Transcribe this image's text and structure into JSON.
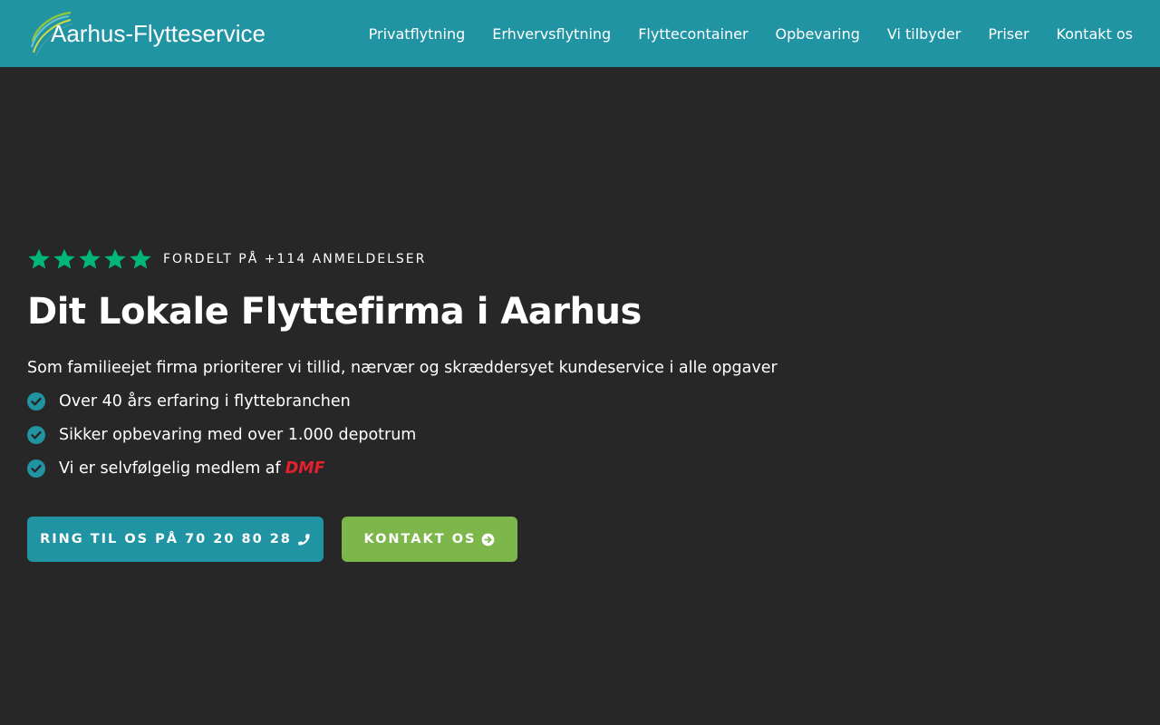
{
  "header": {
    "logo_text": "Aarhus-Flytteservice",
    "nav": [
      {
        "label": "Privatflytning"
      },
      {
        "label": "Erhvervsflytning"
      },
      {
        "label": "Flyttecontainer"
      },
      {
        "label": "Opbevaring"
      },
      {
        "label": "Vi tilbyder"
      },
      {
        "label": "Priser"
      },
      {
        "label": "Kontakt os"
      }
    ]
  },
  "hero": {
    "rating": {
      "stars": 5,
      "text": "FORDELT PÅ +114 ANMELDELSER"
    },
    "title": "Dit Lokale Flyttefirma i Aarhus",
    "lead": "Som familieejet firma prioriterer vi tillid, nærvær og skræddersyet kundeservice i alle opgaver",
    "checks": [
      {
        "text": "Over 40 års erfaring i flyttebranchen"
      },
      {
        "text": "Sikker opbevaring med over 1.000 depotrum"
      },
      {
        "text": "Vi er selvfølgelig medlem af",
        "badge": "DMF"
      }
    ],
    "buttons": {
      "call": "RING TIL OS PÅ 70 20 80 28",
      "contact": "KONTAKT OS"
    }
  },
  "colors": {
    "header_bg": "#2194a3",
    "page_bg": "#272727",
    "star": "#00b67a",
    "check": "#2194a3",
    "dmf": "#e4202f",
    "contact_button": "#7db64a"
  }
}
